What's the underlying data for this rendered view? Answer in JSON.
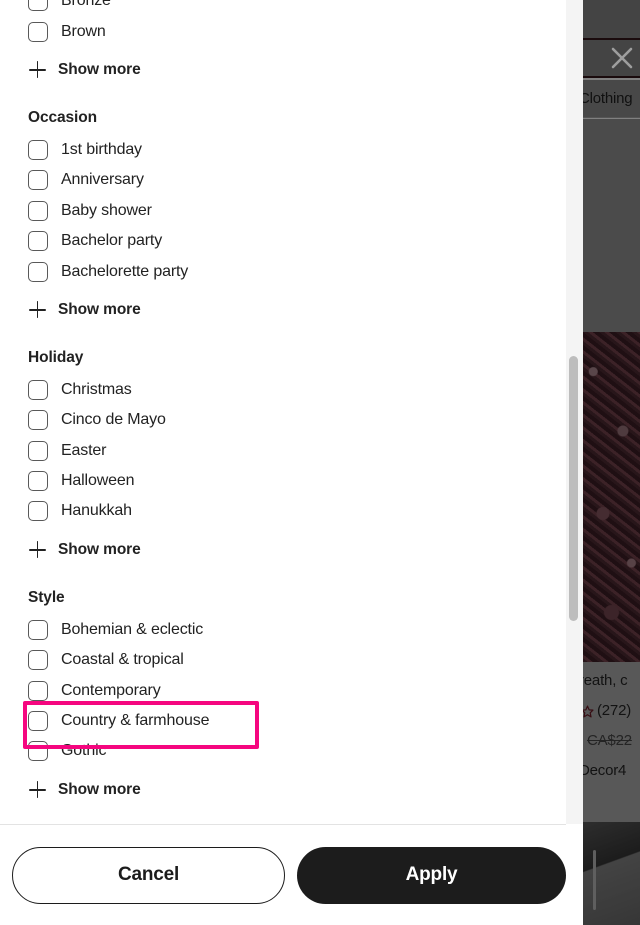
{
  "modal": {
    "name": "filters-dialog",
    "groups": [
      {
        "title": "",
        "options": [
          {
            "label": "Bronze",
            "checked": false
          },
          {
            "label": "Brown",
            "checked": false
          }
        ],
        "show_more": "Show more"
      },
      {
        "title": "Occasion",
        "options": [
          {
            "label": "1st birthday",
            "checked": false
          },
          {
            "label": "Anniversary",
            "checked": false
          },
          {
            "label": "Baby shower",
            "checked": false
          },
          {
            "label": "Bachelor party",
            "checked": false
          },
          {
            "label": "Bachelorette party",
            "checked": false
          }
        ],
        "show_more": "Show more"
      },
      {
        "title": "Holiday",
        "options": [
          {
            "label": "Christmas",
            "checked": false
          },
          {
            "label": "Cinco de Mayo",
            "checked": false
          },
          {
            "label": "Easter",
            "checked": false
          },
          {
            "label": "Halloween",
            "checked": false
          },
          {
            "label": "Hanukkah",
            "checked": false
          }
        ],
        "show_more": "Show more"
      },
      {
        "title": "Style",
        "options": [
          {
            "label": "Bohemian & eclectic",
            "checked": false
          },
          {
            "label": "Coastal & tropical",
            "checked": false
          },
          {
            "label": "Contemporary",
            "checked": false
          },
          {
            "label": "Country & farmhouse",
            "checked": false,
            "highlighted": true
          },
          {
            "label": "Gothic",
            "checked": false
          }
        ],
        "show_more": "Show more"
      }
    ],
    "footer": {
      "cancel_label": "Cancel",
      "apply_label": "Apply"
    }
  },
  "background": {
    "close_icon": "close-icon",
    "breadcrumb": "Clothing",
    "listing": {
      "title": "reath, c",
      "rating_icon": "star-icon",
      "review_count": "(272)",
      "original_price": "CA$22",
      "shop_name": "Decor4"
    }
  },
  "scrollbar": {
    "name": "page-scrollbar"
  },
  "colors": {
    "highlight": "#F5067F",
    "apply_bg": "#1c1c1c",
    "text": "#222222"
  }
}
